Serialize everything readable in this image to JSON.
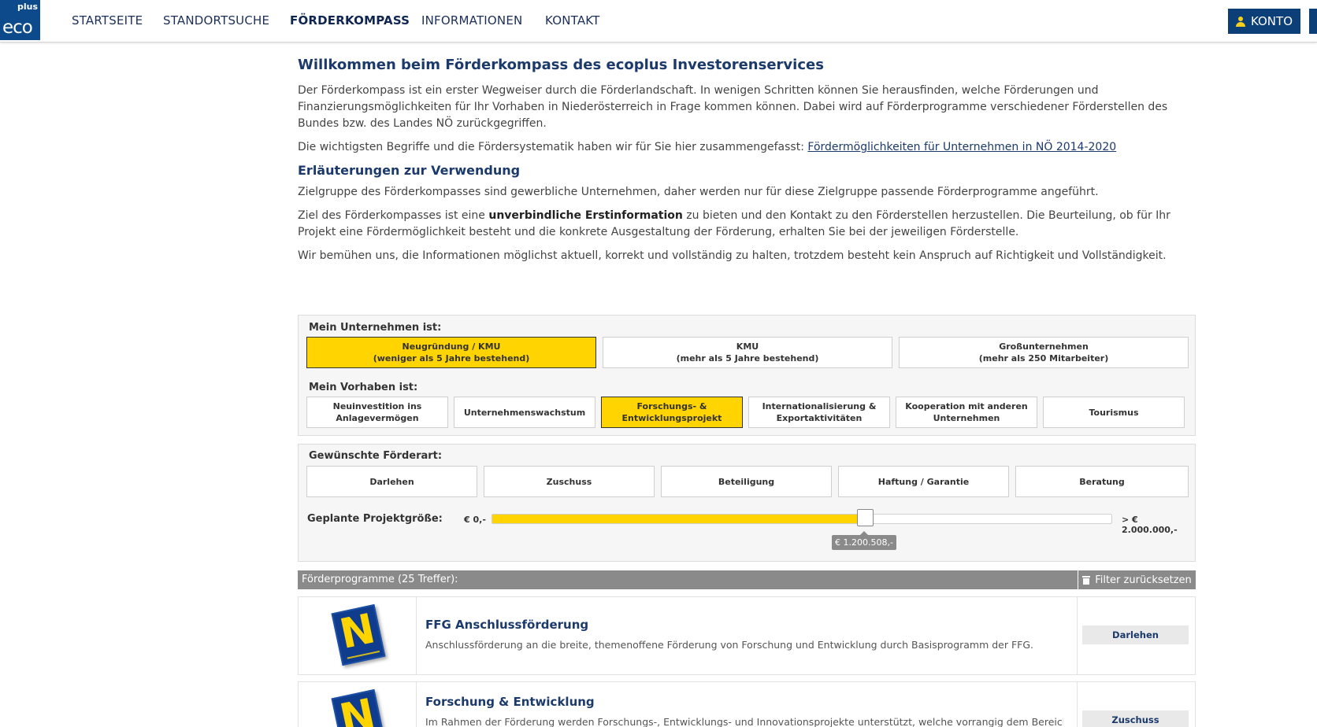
{
  "nav": {
    "logo_top": "plus",
    "logo_main": "eco",
    "items": [
      "STARTSEITE",
      "STANDORTSUCHE",
      "FÖRDERKOMPASS",
      "INFORMATIONEN",
      "KONTAKT"
    ],
    "active_index": 2,
    "konto_label": "KONTO"
  },
  "intro": {
    "title": "Willkommen beim Förderkompass des ecoplus Investorenservices",
    "p1": "Der Förderkompass ist ein erster Wegweiser durch die Förderlandschaft. In wenigen Schritten können Sie herausfinden, welche Förderungen und Finanzierungsmöglichkeiten für Ihr Vorhaben in Niederösterreich in Frage kommen können. Dabei wird auf Förderprogramme verschiedener Förderstellen des Bundes bzw. des Landes NÖ zurückgegriffen.",
    "p2_text": "Die wichtigsten Begriffe und die Fördersystematik haben wir für Sie hier zusammengefasst: ",
    "p2_link": "Fördermöglichkeiten für Unternehmen in NÖ 2014-2020",
    "subtitle": "Erläuterungen zur Verwendung",
    "p3": "Zielgruppe des Förderkompasses sind gewerbliche Unternehmen, daher werden nur für diese Zielgruppe passende Förderprogramme angeführt.",
    "p4_a": "Ziel des Förderkompasses ist eine ",
    "p4_bold": "unverbindliche Erstinformation",
    "p4_b": " zu bieten und den Kontakt zu den Förderstellen herzustellen. Die Beurteilung, ob für Ihr Projekt eine Fördermöglichkeit besteht und die konkrete Ausgestaltung der Förderung, erhalten Sie bei der jeweiligen Förderstelle.",
    "p5": "Wir bemühen uns, die Informationen möglichst aktuell, korrekt und vollständig zu halten, trotzdem besteht kein Anspruch auf Richtigkeit und Vollständigkeit."
  },
  "filters": {
    "unternehmen_label": "Mein Unternehmen ist:",
    "unternehmen": [
      {
        "l1": "Neugründung / KMU",
        "l2": "(weniger als 5 Jahre bestehend)",
        "selected": true
      },
      {
        "l1": "KMU",
        "l2": "(mehr als 5 Jahre bestehend)",
        "selected": false
      },
      {
        "l1": "Großunternehmen",
        "l2": "(mehr als 250 Mitarbeiter)",
        "selected": false
      }
    ],
    "vorhaben_label": "Mein Vorhaben ist:",
    "vorhaben": [
      {
        "l1": "Neuinvestition ins",
        "l2": "Anlagevermögen",
        "selected": false
      },
      {
        "l1": "Unternehmenswachstum",
        "l2": "",
        "selected": false
      },
      {
        "l1": "Forschungs- &",
        "l2": "Entwicklungsprojekt",
        "selected": true
      },
      {
        "l1": "Internationalisierung &",
        "l2": "Exportaktivitäten",
        "selected": false
      },
      {
        "l1": "Kooperation mit anderen",
        "l2": "Unternehmen",
        "selected": false
      },
      {
        "l1": "Tourismus",
        "l2": "",
        "selected": false
      }
    ],
    "foerderart_label": "Gewünschte Förderart:",
    "foerderart": [
      "Darlehen",
      "Zuschuss",
      "Beteiligung",
      "Haftung / Garantie",
      "Beratung"
    ],
    "projekt_label": "Geplante Projektgröße:",
    "slider_min": "€ 0,-",
    "slider_max": "> € 2.000.000,-",
    "slider_value_label": "€ 1.200.508,-",
    "slider_fraction": 0.6
  },
  "results": {
    "header": "Förderprogramme (25 Treffer):",
    "reset_label": "Filter zurücksetzen",
    "items": [
      {
        "title": "FFG Anschlussförderung",
        "desc": "Anschlussförderung an die breite, themenoffene Förderung von Forschung und Entwicklung durch Basisprogramm der FFG.",
        "tag": "Darlehen"
      },
      {
        "title": "Forschung & Entwicklung",
        "desc": "Im Rahmen der Förderung werden Forschungs-, Entwicklungs- und Innovationsprojekte unterstützt, welche vorrangig dem Bereich",
        "tag": "Zuschuss"
      }
    ]
  },
  "colors": {
    "accent": "#ffd400",
    "brand": "#0c3f78",
    "heading": "#1b3a6b"
  }
}
